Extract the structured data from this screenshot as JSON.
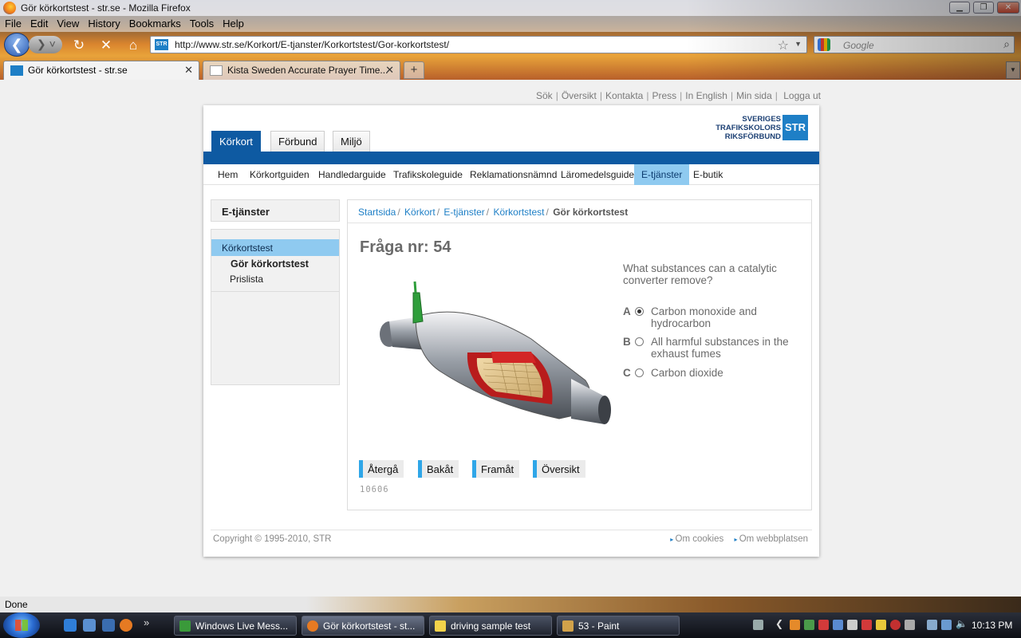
{
  "browser": {
    "window_title": "Gör körkortstest - str.se - Mozilla Firefox",
    "menu": [
      "File",
      "Edit",
      "View",
      "History",
      "Bookmarks",
      "Tools",
      "Help"
    ],
    "url": "http://www.str.se/Korkort/E-tjanster/Korkortstest/Gor-korkortstest/",
    "search_placeholder": "Google",
    "tabs": [
      {
        "label": "Gör körkortstest - str.se",
        "active": true
      },
      {
        "label": "Kista Sweden Accurate Prayer Time...",
        "active": false
      }
    ],
    "new_tab": "+",
    "status": "Done"
  },
  "site": {
    "top_links": [
      "Sök",
      "Översikt",
      "Kontakta",
      "Press",
      "In English",
      "Min sida",
      "Logga ut"
    ],
    "logo": {
      "line1": "SVERIGES",
      "line2": "TRAFIKSKOLORS",
      "line3": "RIKSFÖRBUND",
      "mark": "STR"
    },
    "main_tabs": [
      "Körkort",
      "Förbund",
      "Miljö"
    ],
    "sub_nav": [
      "Hem",
      "Körkortguiden",
      "Handledarguide",
      "Trafikskoleguide",
      "Reklamationsnämnd",
      "Läromedelsguide",
      "E-tjänster",
      "E-butik"
    ],
    "sidebar": {
      "heading": "E-tjänster",
      "parent": "Körkortstest",
      "current": "Gör körkortstest",
      "item": "Prislista"
    },
    "breadcrumb": [
      "Startsida",
      "Körkort",
      "E-tjänster",
      "Körkortstest"
    ],
    "breadcrumb_sep": "/",
    "breadcrumb_current": "Gör körkortstest",
    "question": {
      "title": "Fråga nr: 54",
      "text": "What substances can a catalytic converter remove?",
      "options": [
        {
          "letter": "A",
          "text": "Carbon monoxide and hydrocarbon",
          "selected": true
        },
        {
          "letter": "B",
          "text": "All harmful substances in the exhaust fumes",
          "selected": false
        },
        {
          "letter": "C",
          "text": "Carbon dioxide",
          "selected": false
        }
      ],
      "buttons": [
        "Återgå",
        "Bakåt",
        "Framåt",
        "Översikt"
      ],
      "id": "10606"
    },
    "footer": {
      "copyright": "Copyright © 1995-2010, STR",
      "links": [
        "Om cookies",
        "Om webbplatsen"
      ]
    }
  },
  "taskbar": {
    "tasks": [
      "Windows Live Mess...",
      "Gör körkortstest - st...",
      "driving sample test",
      "53 - Paint"
    ],
    "quicklaunch_more": "»",
    "clock": "10:13 PM"
  },
  "colors": {
    "accent": "#0e5aa2",
    "highlight": "#8fcaf0",
    "link": "#1e7fc6",
    "button_bar": "#2fa6e8"
  }
}
